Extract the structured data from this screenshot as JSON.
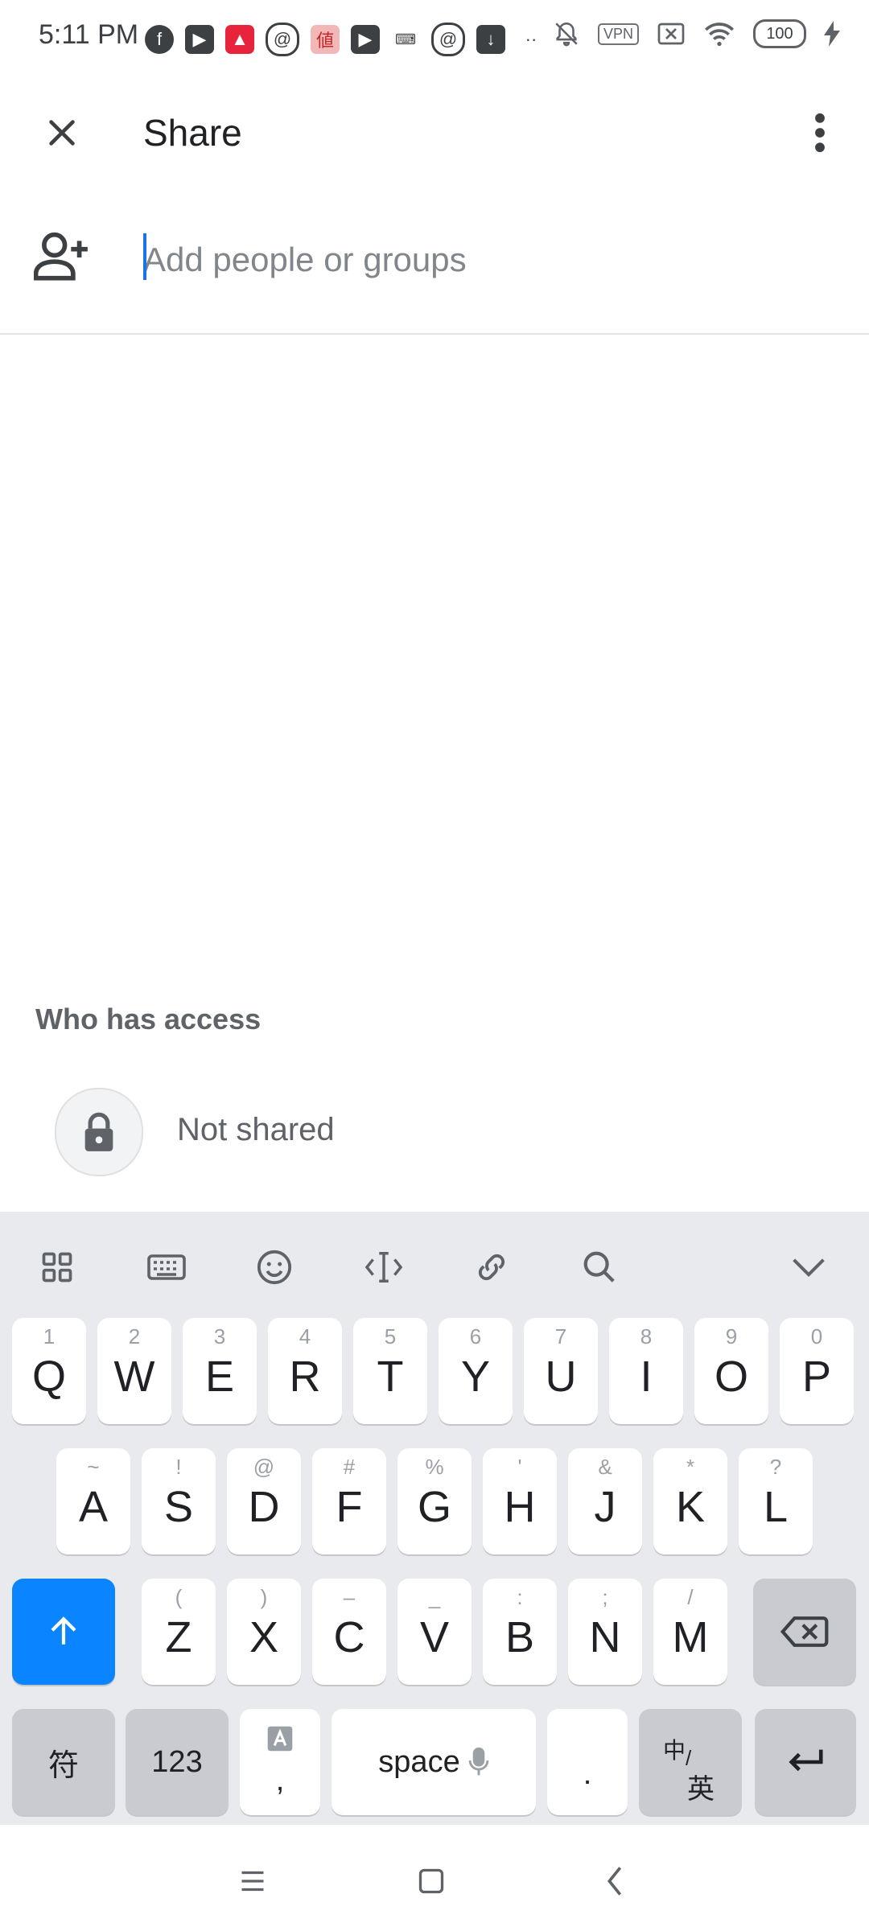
{
  "status_bar": {
    "time": "5:11 PM",
    "vpn": "VPN",
    "battery": "100"
  },
  "app_bar": {
    "title": "Share"
  },
  "add_people": {
    "placeholder": "Add people or groups"
  },
  "access": {
    "section_title": "Who has access",
    "status": "Not shared"
  },
  "keyboard": {
    "row1": [
      {
        "key": "Q",
        "hint": "1"
      },
      {
        "key": "W",
        "hint": "2"
      },
      {
        "key": "E",
        "hint": "3"
      },
      {
        "key": "R",
        "hint": "4"
      },
      {
        "key": "T",
        "hint": "5"
      },
      {
        "key": "Y",
        "hint": "6"
      },
      {
        "key": "U",
        "hint": "7"
      },
      {
        "key": "I",
        "hint": "8"
      },
      {
        "key": "O",
        "hint": "9"
      },
      {
        "key": "P",
        "hint": "0"
      }
    ],
    "row2": [
      {
        "key": "A",
        "hint": "~"
      },
      {
        "key": "S",
        "hint": "!"
      },
      {
        "key": "D",
        "hint": "@"
      },
      {
        "key": "F",
        "hint": "#"
      },
      {
        "key": "G",
        "hint": "%"
      },
      {
        "key": "H",
        "hint": "'"
      },
      {
        "key": "J",
        "hint": "&"
      },
      {
        "key": "K",
        "hint": "*"
      },
      {
        "key": "L",
        "hint": "?"
      }
    ],
    "row3": [
      {
        "key": "Z",
        "hint": "("
      },
      {
        "key": "X",
        "hint": ")"
      },
      {
        "key": "C",
        "hint": "–"
      },
      {
        "key": "V",
        "hint": "_"
      },
      {
        "key": "B",
        "hint": ":"
      },
      {
        "key": "N",
        "hint": ";"
      },
      {
        "key": "M",
        "hint": "/"
      }
    ],
    "symbols_key": "符",
    "numbers_key": "123",
    "comma_key": ",",
    "space_key": "space",
    "period_key": ".",
    "lang_key_top": "中",
    "lang_key_bottom": "英"
  },
  "colors": {
    "accent": "#1a73e8",
    "shift_key": "#0a84ff",
    "keyboard_bg": "#e8eaed"
  }
}
